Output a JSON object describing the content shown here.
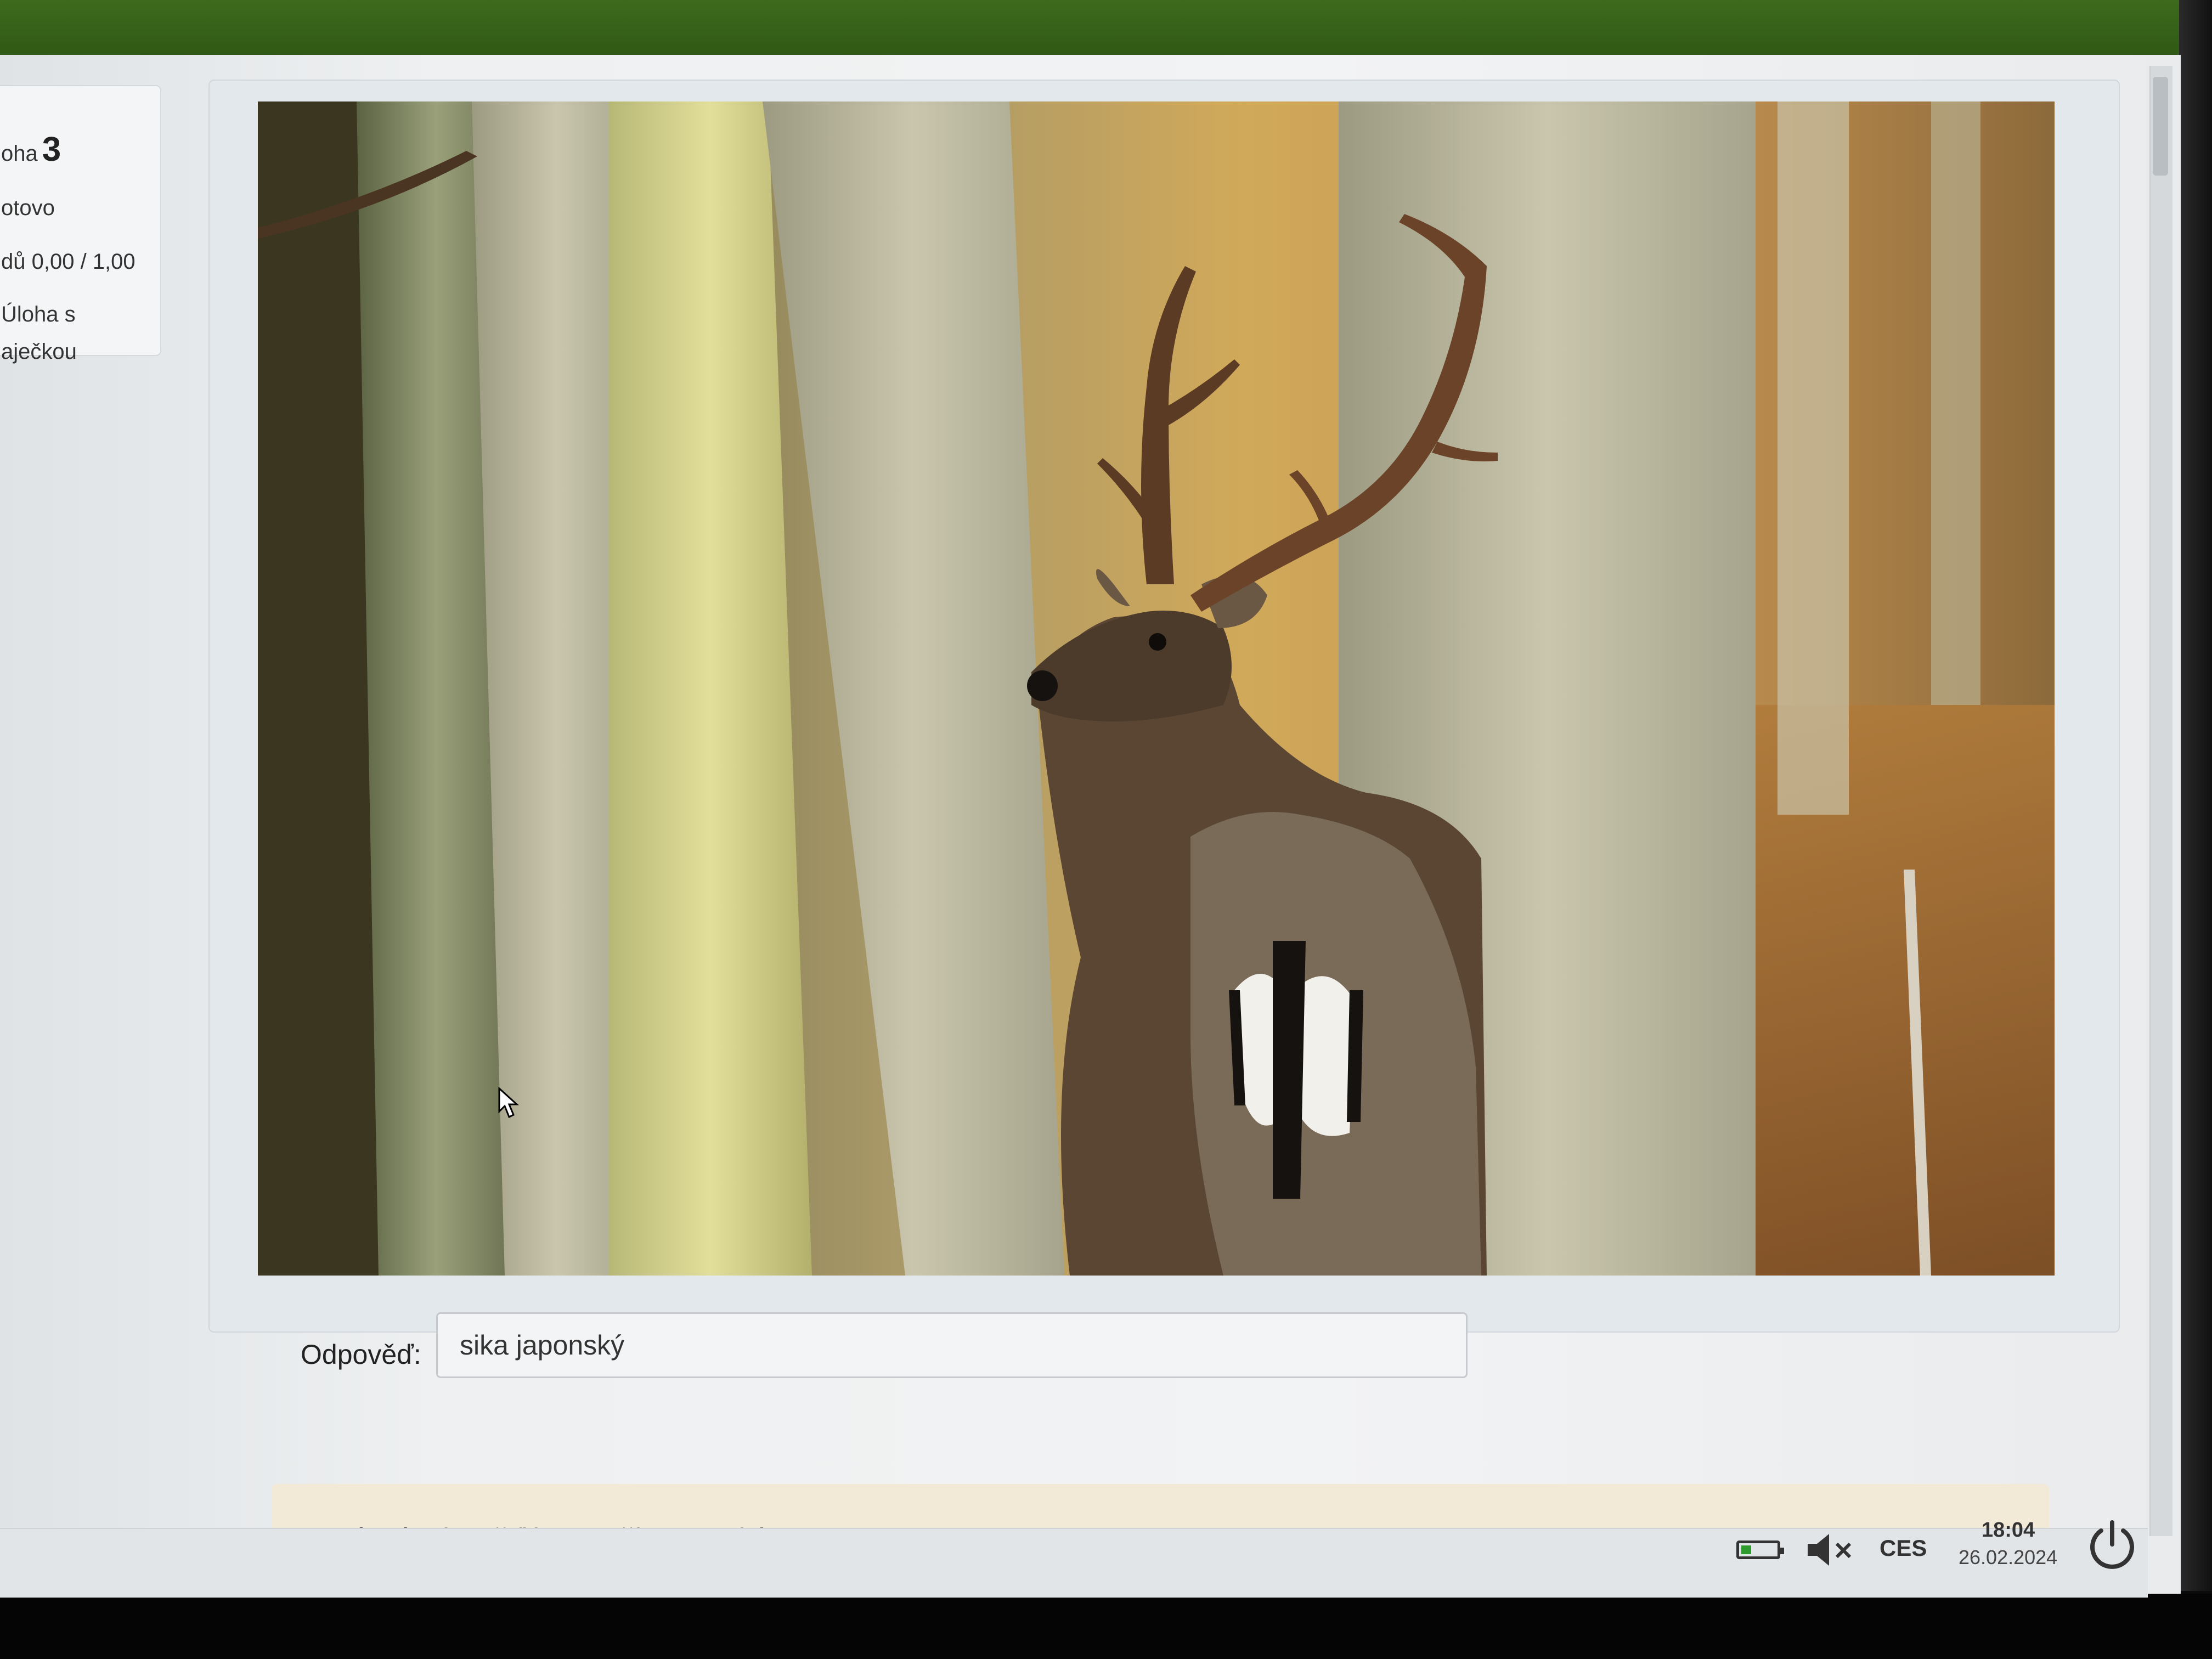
{
  "sidebar": {
    "question_prefix": "oha",
    "question_number": "3",
    "state": "otovo",
    "points": "dů 0,00 / 1,00",
    "type_line1": "Úloha s",
    "type_line2": "aječkou"
  },
  "question": {
    "image_icon": "photo-of-fallow-deer-stag-in-forest",
    "answer_label": "Odpověď:",
    "answer_value": "sika japonský"
  },
  "feedback": {
    "text": "Správná odpověď je: Daněk evropský"
  },
  "taskbar": {
    "language": "CES",
    "time": "18:04",
    "date": "26.02.2024",
    "icons": [
      "battery-icon",
      "volume-muted-icon",
      "power-icon"
    ]
  }
}
